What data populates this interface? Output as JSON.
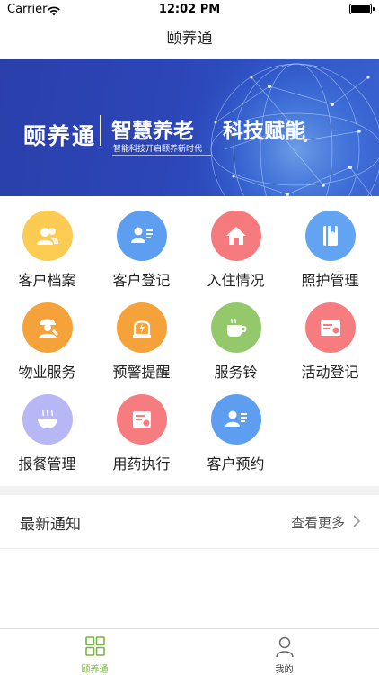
{
  "status_bar": {
    "carrier": "Carrier",
    "time": "12:02 PM"
  },
  "nav": {
    "title": "颐养通"
  },
  "banner": {
    "brand": "颐养通",
    "slogan_part1": "智慧养老",
    "slogan_part2": "科技赋能",
    "subtitle": "智能科技开启颐养新时代"
  },
  "menu": [
    {
      "label": "客户档案",
      "icon": "people-icon",
      "color": "#fccb52"
    },
    {
      "label": "客户登记",
      "icon": "id-card-icon",
      "color": "#5e9ef1"
    },
    {
      "label": "入住情况",
      "icon": "home-icon",
      "color": "#f57a7d"
    },
    {
      "label": "照护管理",
      "icon": "book-icon",
      "color": "#62a3f2"
    },
    {
      "label": "物业服务",
      "icon": "worker-icon",
      "color": "#f6a23a"
    },
    {
      "label": "预警提醒",
      "icon": "alarm-icon",
      "color": "#f6a23a"
    },
    {
      "label": "服务铃",
      "icon": "cup-icon",
      "color": "#94c96b"
    },
    {
      "label": "活动登记",
      "icon": "ticket-icon",
      "color": "#f67c80"
    },
    {
      "label": "报餐管理",
      "icon": "bowl-icon",
      "color": "#b8b7f6"
    },
    {
      "label": "用药执行",
      "icon": "receipt-icon",
      "color": "#f67c80"
    },
    {
      "label": "客户预约",
      "icon": "person-card-icon",
      "color": "#5e9ef1"
    }
  ],
  "notice": {
    "title": "最新通知",
    "more": "查看更多"
  },
  "tabbar": {
    "active_color": "#7cb342",
    "tabs": [
      {
        "label": "颐养通"
      },
      {
        "label": "我的"
      }
    ]
  }
}
